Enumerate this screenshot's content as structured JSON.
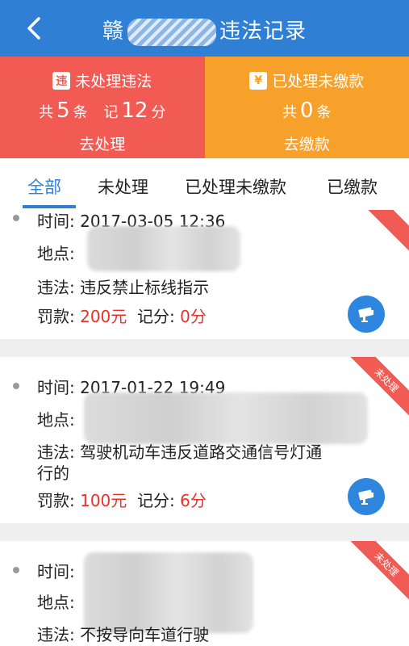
{
  "header": {
    "title_prefix": "赣",
    "title_suffix": "违法记录"
  },
  "summary": {
    "unprocessed": {
      "badge": "违",
      "title": "未处理违法",
      "count_label": "共",
      "count": "5",
      "count_unit": "条",
      "points_label": "记",
      "points": "12",
      "points_unit": "分",
      "action": "去处理"
    },
    "unpaid": {
      "badge": "¥",
      "title": "已处理未缴款",
      "count_label": "共",
      "count": "0",
      "count_unit": "条",
      "action": "去缴款"
    }
  },
  "tabs": [
    "全部",
    "未处理",
    "已处理未缴款",
    "已缴款"
  ],
  "records": [
    {
      "time_label": "时间:",
      "time": "2017-03-05 12:36",
      "location_label": "地点:",
      "violation_label": "违法:",
      "violation": "违反禁止标线指示",
      "fine_label": "罚款:",
      "fine": "200元",
      "points_label": "记分:",
      "points": "0分"
    },
    {
      "time_label": "时间:",
      "time": "2017-01-22 19:49",
      "location_label": "地点:",
      "violation_label": "违法:",
      "violation_line1": "驾驶机动车违反道路交通信号灯通",
      "violation_line2": "行的",
      "fine_label": "罚款:",
      "fine": "100元",
      "points_label": "记分:",
      "points": "6分",
      "status": "未处理"
    },
    {
      "time_label": "时间:",
      "location_label": "地点:",
      "violation_label": "违法:",
      "violation": "不按导向车道行驶",
      "status": "未处理"
    }
  ],
  "colors": {
    "primary": "#2f7fd5",
    "red": "#f25a54",
    "orange": "#f7a02a",
    "fine": "#e8312b"
  }
}
